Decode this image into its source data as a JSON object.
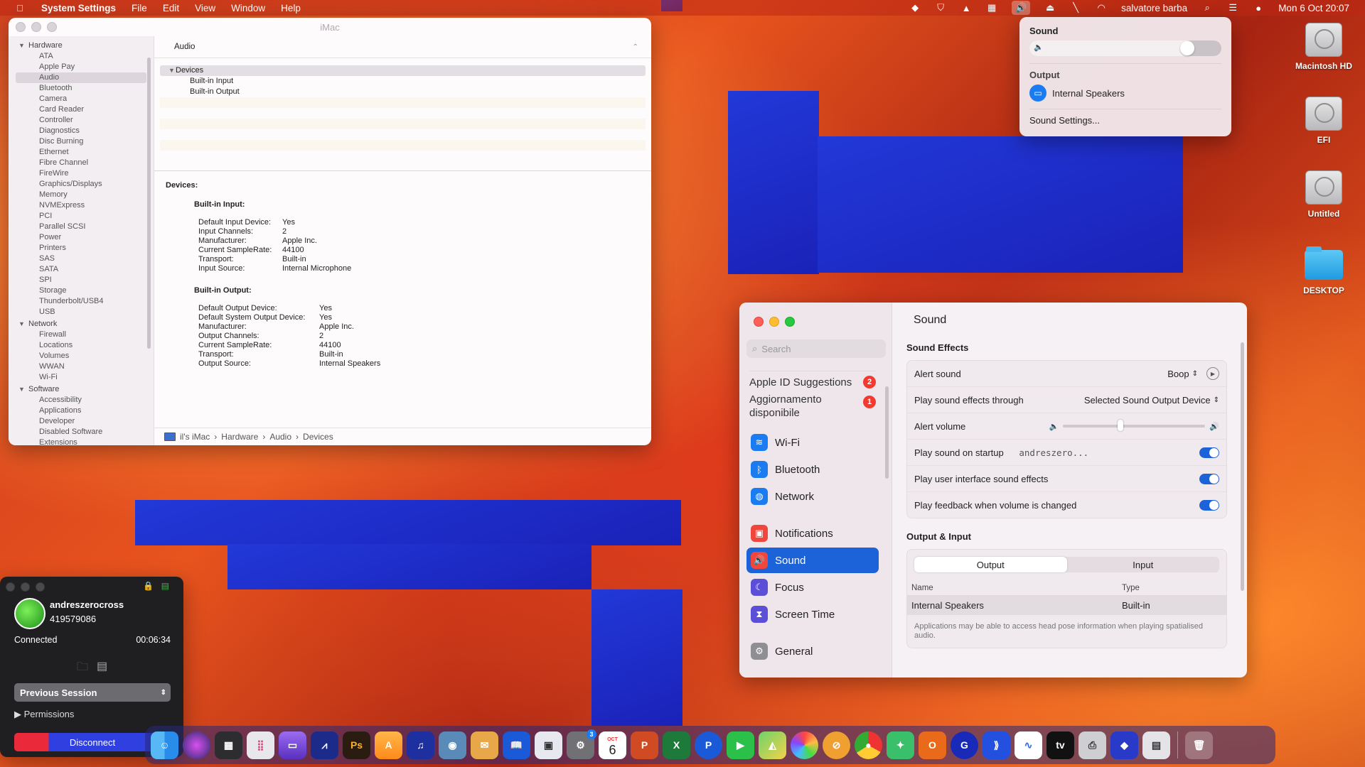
{
  "menubar": {
    "app": "System Settings",
    "menus": [
      "File",
      "Edit",
      "View",
      "Window",
      "Help"
    ],
    "user": "salvatore barba",
    "datetime": "Mon 6 Oct  20:07"
  },
  "sysinfo": {
    "title": "iMac",
    "sidebar": {
      "hardware": "Hardware",
      "hardware_items": [
        "ATA",
        "Apple Pay",
        "Audio",
        "Bluetooth",
        "Camera",
        "Card Reader",
        "Controller",
        "Diagnostics",
        "Disc Burning",
        "Ethernet",
        "Fibre Channel",
        "FireWire",
        "Graphics/Displays",
        "Memory",
        "NVMExpress",
        "PCI",
        "Parallel SCSI",
        "Power",
        "Printers",
        "SAS",
        "SATA",
        "SPI",
        "Storage",
        "Thunderbolt/USB4",
        "USB"
      ],
      "network": "Network",
      "network_items": [
        "Firewall",
        "Locations",
        "Volumes",
        "WWAN",
        "Wi-Fi"
      ],
      "software": "Software",
      "software_items": [
        "Accessibility",
        "Applications",
        "Developer",
        "Disabled Software",
        "Extensions"
      ]
    },
    "list_header": "Audio",
    "list": {
      "group": "Devices",
      "items": [
        "Built-in Input",
        "Built-in Output"
      ]
    },
    "detail": {
      "heading": "Devices:",
      "input_title": "Built-in Input:",
      "input": [
        [
          "Default Input Device:",
          "Yes"
        ],
        [
          "Input Channels:",
          "2"
        ],
        [
          "Manufacturer:",
          "Apple Inc."
        ],
        [
          "Current SampleRate:",
          "44100"
        ],
        [
          "Transport:",
          "Built-in"
        ],
        [
          "Input Source:",
          "Internal Microphone"
        ]
      ],
      "output_title": "Built-in Output:",
      "output": [
        [
          "Default Output Device:",
          "Yes"
        ],
        [
          "Default System Output Device:",
          "Yes"
        ],
        [
          "Manufacturer:",
          "Apple Inc."
        ],
        [
          "Output Channels:",
          "2"
        ],
        [
          "Current SampleRate:",
          "44100"
        ],
        [
          "Transport:",
          "Built-in"
        ],
        [
          "Output Source:",
          "Internal Speakers"
        ]
      ]
    },
    "path": [
      "il's iMac",
      "Hardware",
      "Audio",
      "Devices"
    ]
  },
  "sound_menu": {
    "title": "Sound",
    "volume": 0.86,
    "output_label": "Output",
    "device": "Internal Speakers",
    "settings_link": "Sound Settings..."
  },
  "desktop": [
    "Macintosh HD",
    "EFI",
    "Untitled",
    "DESKTOP"
  ],
  "settings": {
    "search_placeholder": "Search",
    "apple_id_suggestions": "Apple ID Suggestions",
    "apple_id_badge": "2",
    "update_label": "Aggiornamento disponibile",
    "update_badge": "1",
    "sidebar": [
      {
        "label": "Wi-Fi",
        "color": "#1a7cf0",
        "glyph": "≋"
      },
      {
        "label": "Bluetooth",
        "color": "#1a7cf0",
        "glyph": "ᛒ"
      },
      {
        "label": "Network",
        "color": "#1a7cf0",
        "glyph": "◍"
      },
      {
        "label": "Notifications",
        "color": "#f0463c",
        "glyph": "▣"
      },
      {
        "label": "Sound",
        "color": "#f0463c",
        "glyph": "🔊"
      },
      {
        "label": "Focus",
        "color": "#5b4fd8",
        "glyph": "☾"
      },
      {
        "label": "Screen Time",
        "color": "#5b4fd8",
        "glyph": "⧗"
      },
      {
        "label": "General",
        "color": "#8e8e93",
        "glyph": "⚙"
      }
    ],
    "title": "Sound",
    "effects_label": "Sound Effects",
    "alert_sound_label": "Alert sound",
    "alert_sound_value": "Boop",
    "play_through_label": "Play sound effects through",
    "play_through_value": "Selected Sound Output Device",
    "alert_volume_label": "Alert volume",
    "alert_volume": 0.4,
    "startup_label": "Play sound on startup",
    "overlay_user": "andreszero...",
    "ui_sounds_label": "Play user interface sound effects",
    "feedback_label": "Play feedback when volume is changed",
    "output_input_label": "Output & Input",
    "tab_output": "Output",
    "tab_input": "Input",
    "col_name": "Name",
    "col_type": "Type",
    "row_name": "Internal Speakers",
    "row_type": "Built-in",
    "note": "Applications may be able to access head pose information when playing spatialised audio."
  },
  "remote": {
    "name": "andreszerocross",
    "id": "419579086",
    "status": "Connected",
    "timer": "00:06:34",
    "session": "Previous Session",
    "permissions": "Permissions",
    "disconnect": "Disconnect"
  },
  "dock": {
    "badges": {
      "settings": "3",
      "calendar_month": "OCT",
      "calendar_day": "6"
    }
  }
}
